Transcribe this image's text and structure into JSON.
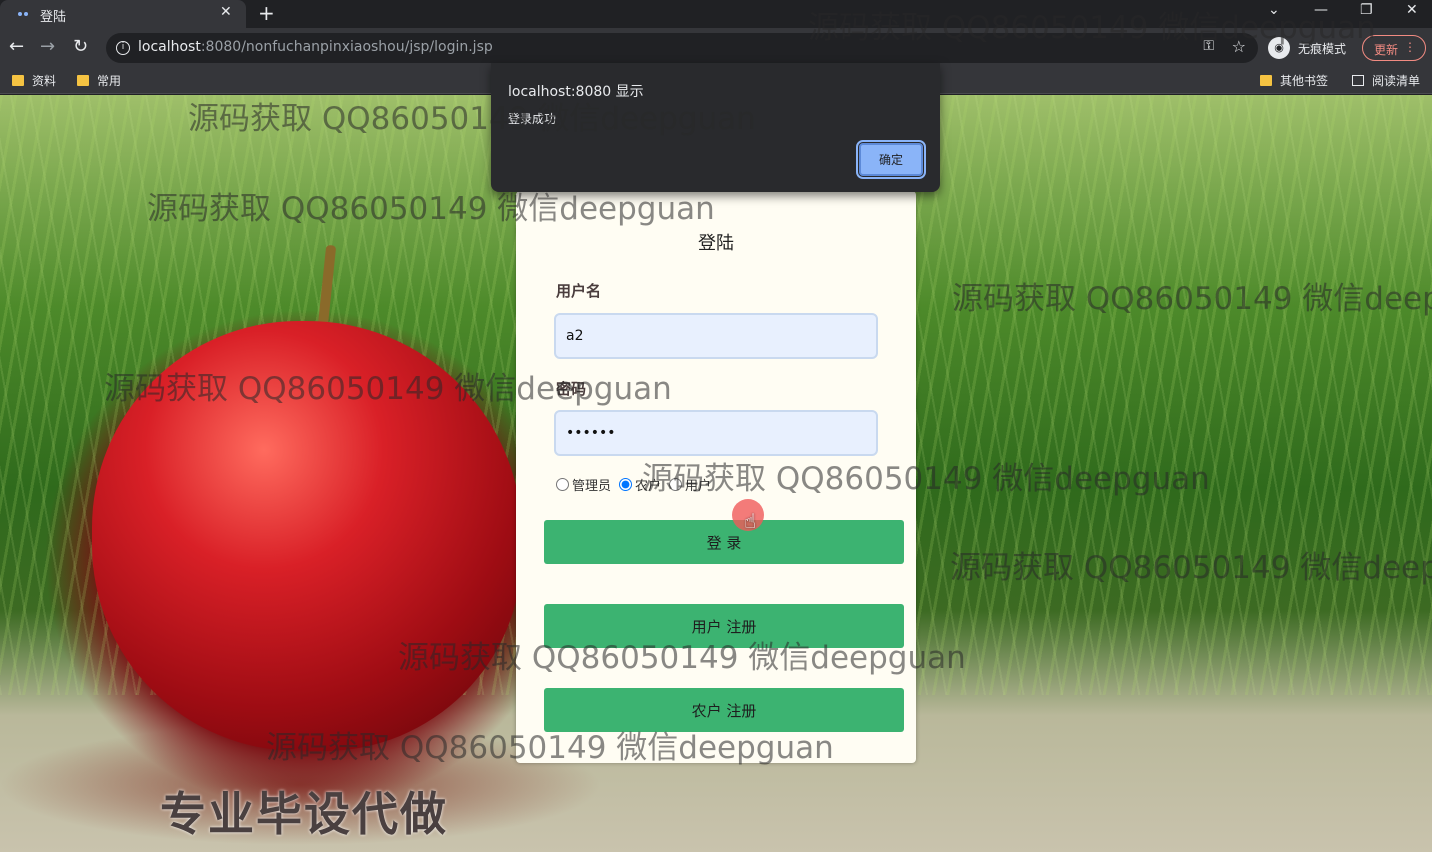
{
  "tab": {
    "title": "登陆",
    "close": "✕",
    "new_tab": "+"
  },
  "window_controls": {
    "menu": "⌄",
    "minimize": "—",
    "restore": "❐",
    "close": "✕"
  },
  "toolbar": {
    "back": "←",
    "forward": "→",
    "reload": "↻",
    "url_host": "localhost",
    "url_rest": ":8080/nonfuchanpinxiaoshou/jsp/login.jsp",
    "key": "⚿",
    "star": "☆",
    "incognito_label": "无痕模式",
    "update_label": "更新",
    "menu_dots": "⋮"
  },
  "bookmarks": {
    "left": [
      "资料",
      "常用"
    ],
    "other": "其他书签",
    "reading_list": "阅读清单"
  },
  "alert": {
    "title": "localhost:8080 显示",
    "message": "登录成功",
    "ok_label": "确定"
  },
  "login": {
    "title": "登陆",
    "username_label": "用户名",
    "username_value": "a2",
    "password_label": "密码",
    "password_value": "••••••",
    "roles": [
      "管理员",
      "农户",
      "用户"
    ],
    "selected_role": "农户",
    "login_button": "登 录",
    "user_register_button": "用户 注册",
    "farmer_register_button": "农户 注册"
  },
  "promo_text": "专业毕设代做",
  "watermark": "源码获取 QQ86050149 微信deepguan"
}
